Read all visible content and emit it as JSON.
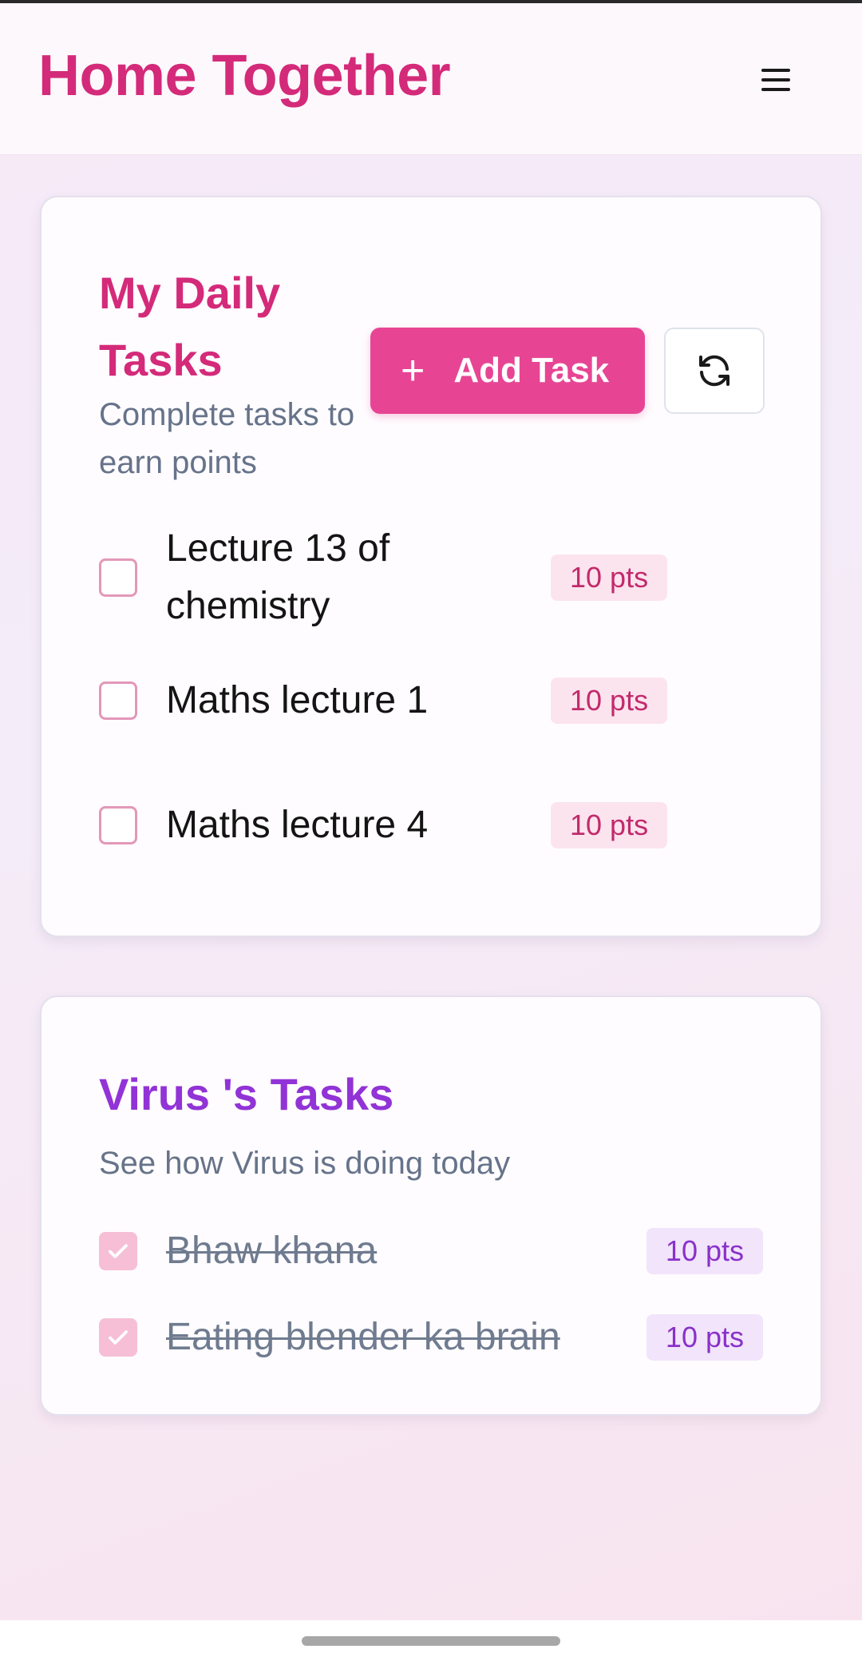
{
  "app": {
    "title": "Home Together"
  },
  "header": {
    "menu_icon": "hamburger-menu-icon"
  },
  "my_tasks": {
    "title": "My Daily Tasks",
    "subtitle": "Complete tasks to earn points",
    "add_button_label": "Add Task",
    "add_icon": "plus-icon",
    "refresh_icon": "refresh-icon",
    "accent_color": "#d42a7a",
    "items": [
      {
        "label": "Lecture 13 of chemistry",
        "points": "10 pts",
        "checked": false
      },
      {
        "label": "Maths lecture 1",
        "points": "10 pts",
        "checked": false
      },
      {
        "label": "Maths lecture 4",
        "points": "10 pts",
        "checked": false
      }
    ]
  },
  "partner_tasks": {
    "title": "Virus 's Tasks",
    "subtitle": "See how Virus is doing today",
    "accent_color": "#9133d6",
    "items": [
      {
        "label": "Bhaw khana",
        "points": "10 pts",
        "checked": true
      },
      {
        "label": "Eating blender ka brain",
        "points": "10 pts",
        "checked": true
      }
    ]
  }
}
